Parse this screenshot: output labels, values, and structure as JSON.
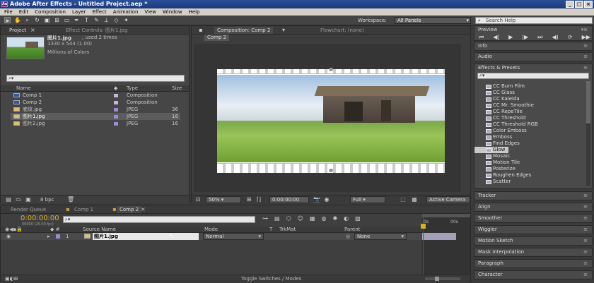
{
  "window": {
    "title": "Adobe After Effects - Untitled Project.aep *"
  },
  "menu": [
    "File",
    "Edit",
    "Composition",
    "Layer",
    "Effect",
    "Animation",
    "View",
    "Window",
    "Help"
  ],
  "toolbar": {
    "workspace_label": "Workspace:",
    "workspace_value": "All Panels",
    "search_help": "Search Help"
  },
  "project": {
    "tab": "Project",
    "effect_controls_tab": "Effect Controls: 图片1.jpg",
    "preview_name": "图片1.jpg",
    "preview_used": ", used 2 times",
    "preview_dims": "1330 x 544 (1.00)",
    "preview_colors": "Millions of Colors",
    "columns": [
      "Name",
      "Type",
      "Size"
    ],
    "items": [
      {
        "name": "Comp 1",
        "type": "Composition",
        "size": "",
        "label_color": "#c8b4dc",
        "icon": "composition-icon"
      },
      {
        "name": "Comp 2",
        "type": "Composition",
        "size": "",
        "label_color": "#c8b4dc",
        "icon": "composition-icon"
      },
      {
        "name": "底纹.jpg",
        "type": "JPEG",
        "size": "36",
        "label_color": "#9c8cd8",
        "icon": "image-file-icon"
      },
      {
        "name": "图片1.jpg",
        "type": "JPEG",
        "size": "16",
        "label_color": "#9c8cd8",
        "icon": "image-file-icon"
      },
      {
        "name": "图片2.jpg",
        "type": "JPEG",
        "size": "16",
        "label_color": "#9c8cd8",
        "icon": "image-file-icon"
      }
    ],
    "bpc": "8 bpc"
  },
  "composition": {
    "tab": "Composition: Comp 2",
    "flowchart_tab": "Flowchart: (none)",
    "comp_tab": "Comp 2",
    "zoom": "50%",
    "timecode": "0:00:00:00",
    "resolution": "Full",
    "camera": "Active Camera"
  },
  "right": {
    "preview": "Preview",
    "info": "Info",
    "audio": "Audio",
    "effects": "Effects & Presets",
    "effects_list": [
      "CC Burn Film",
      "CC Glass",
      "CC Kaleida",
      "CC Mr. Smoothie",
      "CC RepeTile",
      "CC Threshold",
      "CC Threshold RGB",
      "Color Emboss",
      "Emboss",
      "Find Edges",
      "Glow",
      "Mosaic",
      "Motion Tile",
      "Posterize",
      "Roughen Edges",
      "Scatter"
    ],
    "selected_effect": "Glow",
    "panels": [
      "Tracker",
      "Align",
      "Smoother",
      "Wiggler",
      "Motion Sketch",
      "Mask Interpolation",
      "Paragraph",
      "Character"
    ]
  },
  "timeline": {
    "tabs": [
      "Render Queue",
      "Comp 1",
      "Comp 2"
    ],
    "timecode": "0:00:00:00",
    "fps": "00000 (25.00 fps)",
    "columns": {
      "source": "Source Name",
      "mode": "Mode",
      "t": "T",
      "trkmat": "TrkMat",
      "parent": "Parent"
    },
    "layer": {
      "num": "1",
      "name": "图片1.jpg",
      "mode": "Normal",
      "parent": "None"
    },
    "ruler": [
      "0s",
      "00s"
    ],
    "toggle": "Toggle Switches / Modes"
  }
}
